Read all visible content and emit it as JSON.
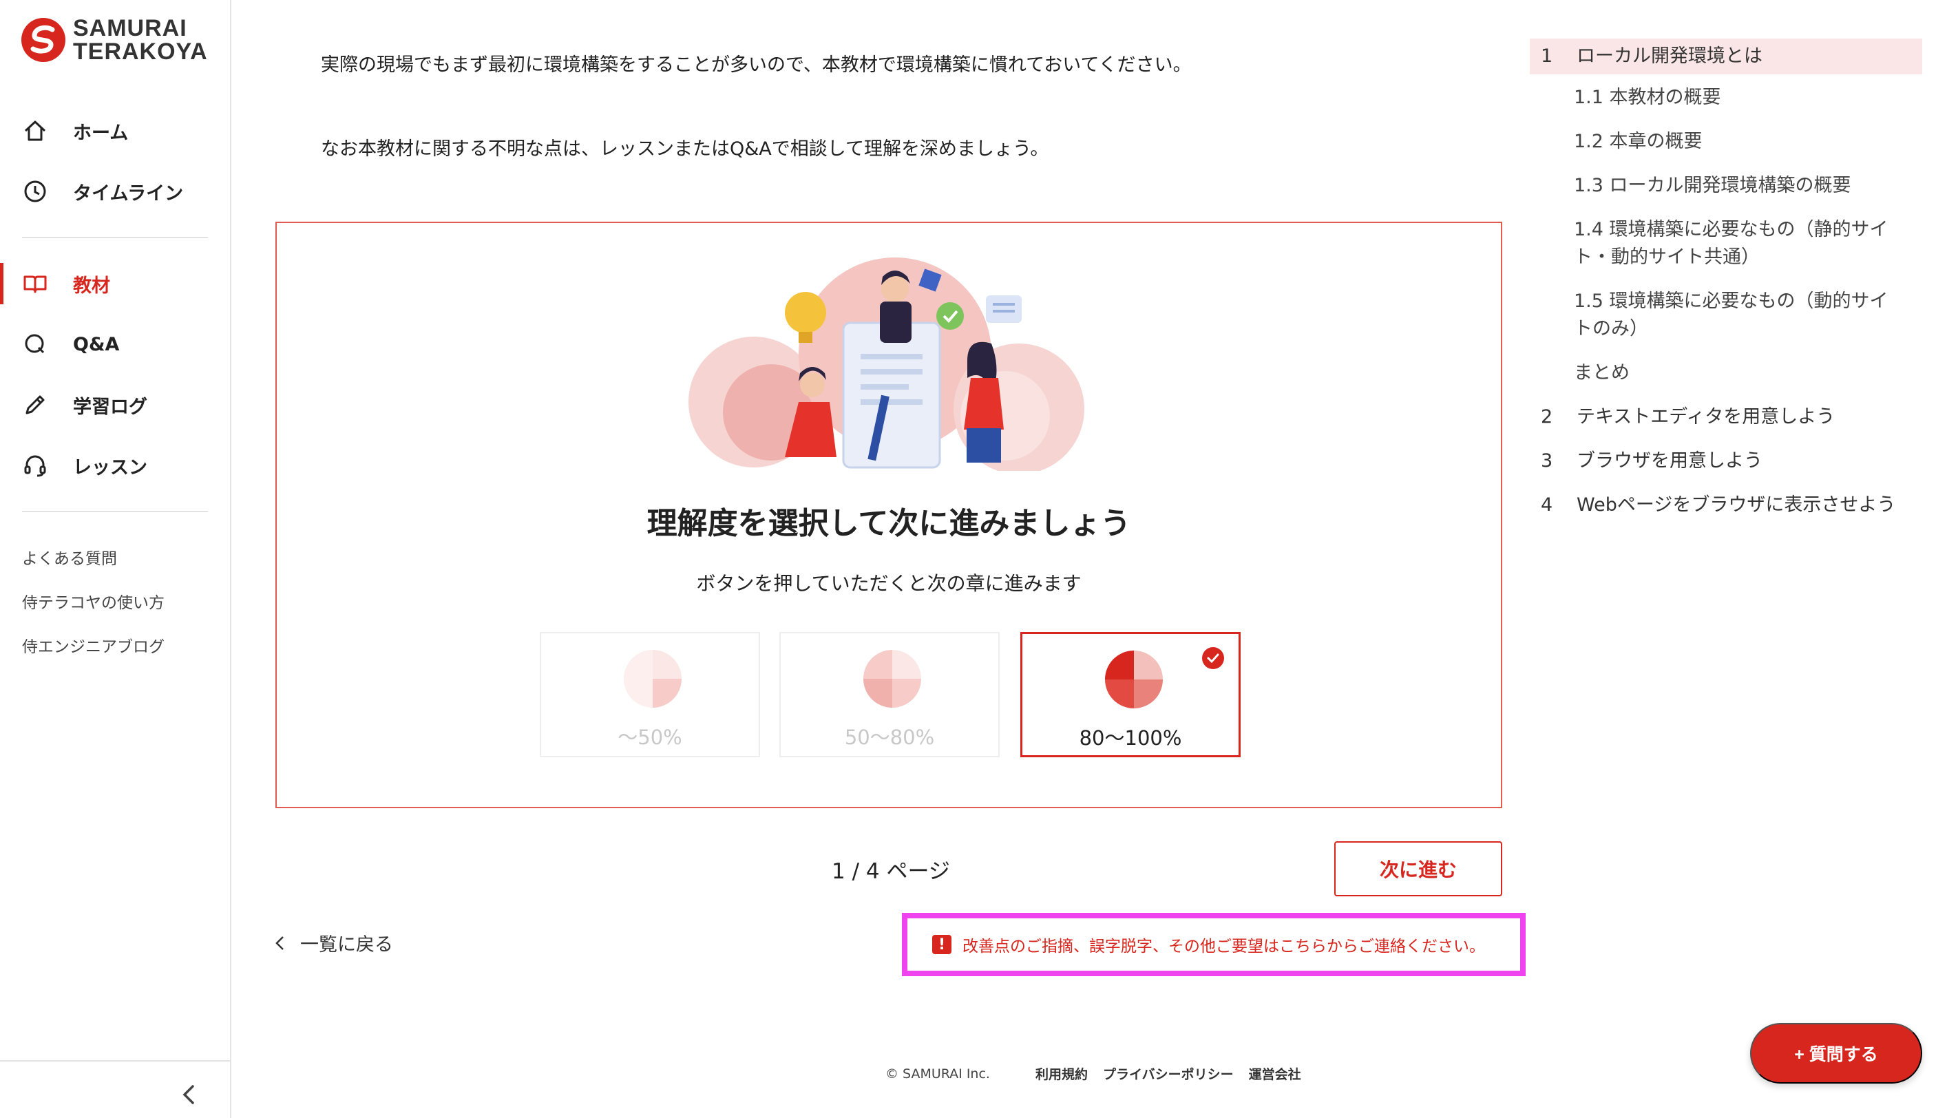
{
  "brand": {
    "line1": "SAMURAI",
    "line2": "TERAKOYA",
    "accent": "#d7261e"
  },
  "sidebar": {
    "nav": [
      {
        "label": "ホーム",
        "icon": "home-icon"
      },
      {
        "label": "タイムライン",
        "icon": "clock-icon"
      },
      {
        "label": "教材",
        "icon": "book-icon",
        "active": true
      },
      {
        "label": "Q&A",
        "icon": "qa-icon"
      },
      {
        "label": "学習ログ",
        "icon": "pencil-icon"
      },
      {
        "label": "レッスン",
        "icon": "headset-icon"
      }
    ],
    "links": [
      "よくある質問",
      "侍テラコヤの使い方",
      "侍エンジニアブログ"
    ]
  },
  "content": {
    "p1": "実際の現場でもまず最初に環境構築をすることが多いので、本教材で環境構築に慣れておいてください。",
    "p2": "なお本教材に関する不明な点は、レッスンまたはQ&Aで相談して理解を深めましょう。"
  },
  "rating": {
    "title": "理解度を選択して次に進みましょう",
    "subtitle": "ボタンを押していただくと次の章に進みます",
    "options": [
      {
        "label": "〜50%",
        "fraction": 0.5
      },
      {
        "label": "50〜80%",
        "fraction": 0.75
      },
      {
        "label": "80〜100%",
        "fraction": 1.0,
        "selected": true
      }
    ]
  },
  "pager": {
    "text": "1 / 4 ページ"
  },
  "next_button": "次に進む",
  "back_link": "一覧に戻る",
  "feedback": {
    "icon": "!",
    "text": "改善点のご指摘、誤字脱字、その他ご要望はこちらからご連絡ください。"
  },
  "footer": {
    "copyright": "© SAMURAI Inc.",
    "links": [
      "利用規約",
      "プライバシーポリシー",
      "運営会社"
    ]
  },
  "ask_button": "+ 質問する",
  "toc": [
    {
      "type": "ch",
      "num": "1",
      "label": "ローカル開発環境とは",
      "active": true
    },
    {
      "type": "sec",
      "label": "1.1 本教材の概要"
    },
    {
      "type": "sec",
      "label": "1.2 本章の概要"
    },
    {
      "type": "sec",
      "label": "1.3 ローカル開発環境構築の概要"
    },
    {
      "type": "sec",
      "label": "1.4 環境構築に必要なもの（静的サイト・動的サイト共通）"
    },
    {
      "type": "sec",
      "label": "1.5 環境構築に必要なもの（動的サイトのみ）"
    },
    {
      "type": "sec",
      "label": "まとめ"
    },
    {
      "type": "ch",
      "num": "2",
      "label": "テキストエディタを用意しよう"
    },
    {
      "type": "ch",
      "num": "3",
      "label": "ブラウザを用意しよう"
    },
    {
      "type": "ch",
      "num": "4",
      "label": "Webページをブラウザに表示させよう"
    }
  ]
}
